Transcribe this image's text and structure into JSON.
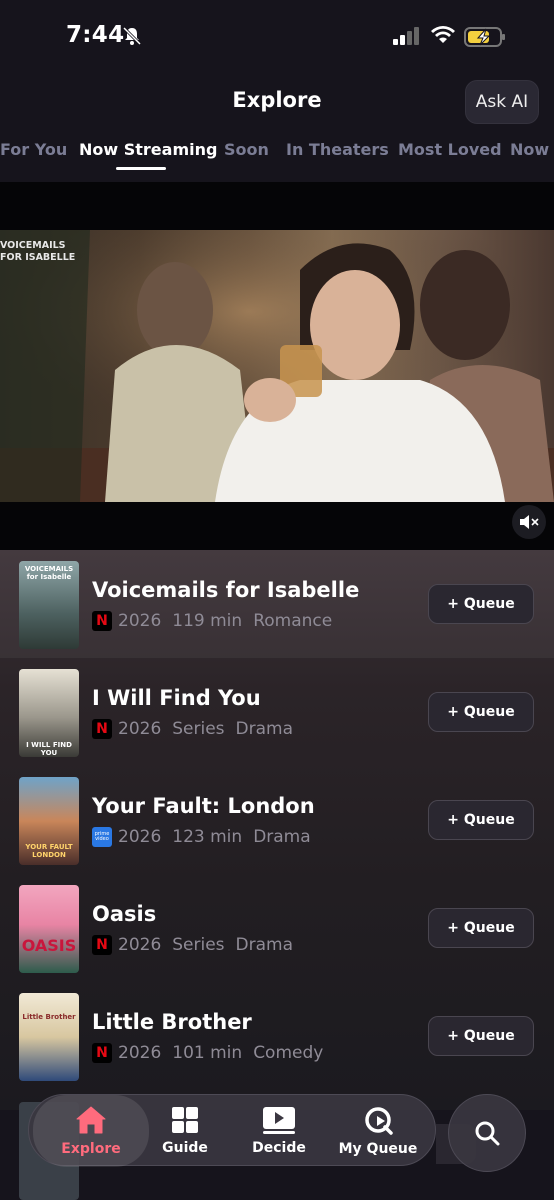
{
  "status_bar": {
    "time": "7:44"
  },
  "header": {
    "title": "Explore",
    "ask_ai_label": "Ask AI"
  },
  "tabs": [
    {
      "label": "For You"
    },
    {
      "label": "Now Streaming",
      "active": true
    },
    {
      "label": "Soon"
    },
    {
      "label": "In Theaters"
    },
    {
      "label": "Most Loved"
    },
    {
      "label": "Now A"
    }
  ],
  "featured_video": {
    "title_overlay": "VOICEMAILS FOR ISABELLE"
  },
  "list": [
    {
      "title": "Voicemails for Isabelle",
      "service": "netflix",
      "year": "2026",
      "duration": "119 min",
      "genre": "Romance",
      "queue_label": "+ Queue",
      "poster_text": "VOICEMAILS for Isabelle",
      "poster_color": "#5c6e73"
    },
    {
      "title": "I Will Find You",
      "service": "netflix",
      "year": "2026",
      "duration": "Series",
      "genre": "Drama",
      "queue_label": "+ Queue",
      "poster_text": "I WILL FIND YOU",
      "poster_color": "#c9c2b0"
    },
    {
      "title": "Your Fault: London",
      "service": "prime",
      "year": "2026",
      "duration": "123 min",
      "genre": "Drama",
      "queue_label": "+ Queue",
      "poster_text": "YOUR FAULT LONDON",
      "poster_color": "#b97a4e"
    },
    {
      "title": "Oasis",
      "service": "netflix",
      "year": "2026",
      "duration": "Series",
      "genre": "Drama",
      "queue_label": "+ Queue",
      "poster_text": "OASIS",
      "poster_color": "#e88aa8"
    },
    {
      "title": "Little Brother",
      "service": "netflix",
      "year": "2026",
      "duration": "101 min",
      "genre": "Comedy",
      "queue_label": "+ Queue",
      "poster_text": "Little Brother",
      "poster_color": "#d9c9a8"
    }
  ],
  "bottom_nav": [
    {
      "label": "Explore",
      "icon": "home-icon",
      "active": true
    },
    {
      "label": "Guide",
      "icon": "grid-icon"
    },
    {
      "label": "Decide",
      "icon": "play-icon"
    },
    {
      "label": "My Queue",
      "icon": "queue-icon"
    }
  ],
  "service_labels": {
    "netflix": "N",
    "prime": "prime video"
  },
  "colors": {
    "active_tab": "#ffffff",
    "inactive_tab": "#7b7d95",
    "nav_active": "#ff6b7d",
    "netflix": "#e50914",
    "prime": "#2a78e4"
  }
}
